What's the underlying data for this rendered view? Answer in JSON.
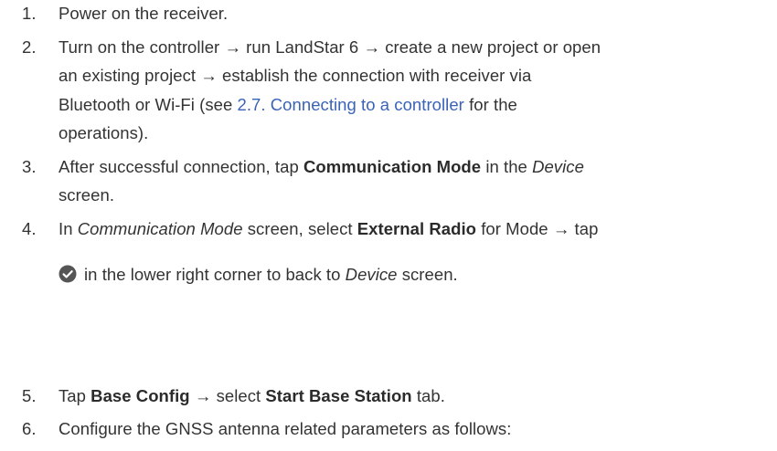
{
  "steps": [
    {
      "number": "1.",
      "lines": [
        [
          {
            "t": "Power on the receiver."
          }
        ]
      ]
    },
    {
      "number": "2.",
      "lines": [
        [
          {
            "t": "Turn on the controller → run LandStar 6 → create a new project or open"
          }
        ],
        [
          {
            "t": "an existing project → establish the connection with receiver via"
          }
        ],
        [
          {
            "t": "Bluetooth or Wi-Fi (see "
          },
          {
            "t": "2.7. Connecting to a controller",
            "s": "link"
          },
          {
            "t": " for the"
          }
        ],
        [
          {
            "t": "operations)."
          }
        ]
      ]
    },
    {
      "number": "3.",
      "lines": [
        [
          {
            "t": "After successful connection, tap "
          },
          {
            "t": "Communication Mode",
            "s": "bold"
          },
          {
            "t": " in the "
          },
          {
            "t": "Device",
            "s": "italic"
          }
        ],
        [
          {
            "t": "screen."
          }
        ]
      ]
    },
    {
      "number": "4.",
      "lines": [
        [
          {
            "t": "In "
          },
          {
            "t": "Communication Mode",
            "s": "italic"
          },
          {
            "t": " screen, select "
          },
          {
            "t": "External Radio",
            "s": "bold"
          },
          {
            "t": " for Mode → tap"
          }
        ],
        [
          {
            "icon": "check-circle-icon"
          },
          {
            "t": "in the lower right corner to back to "
          },
          {
            "t": "Device",
            "s": "italic"
          },
          {
            "t": " screen."
          }
        ]
      ]
    },
    {
      "number": "5.",
      "lines": [
        [
          {
            "t": "Tap "
          },
          {
            "t": "Base Config",
            "s": "bold"
          },
          {
            "t": " → select "
          },
          {
            "t": "Start Base Station",
            "s": "bold"
          },
          {
            "t": " tab."
          }
        ]
      ]
    },
    {
      "number": "6.",
      "lines": [
        [
          {
            "t": "Configure the GNSS antenna related parameters as follows:"
          }
        ]
      ]
    }
  ],
  "colors": {
    "text": "#333333",
    "link": "#3a63b8",
    "icon": "#555555"
  }
}
